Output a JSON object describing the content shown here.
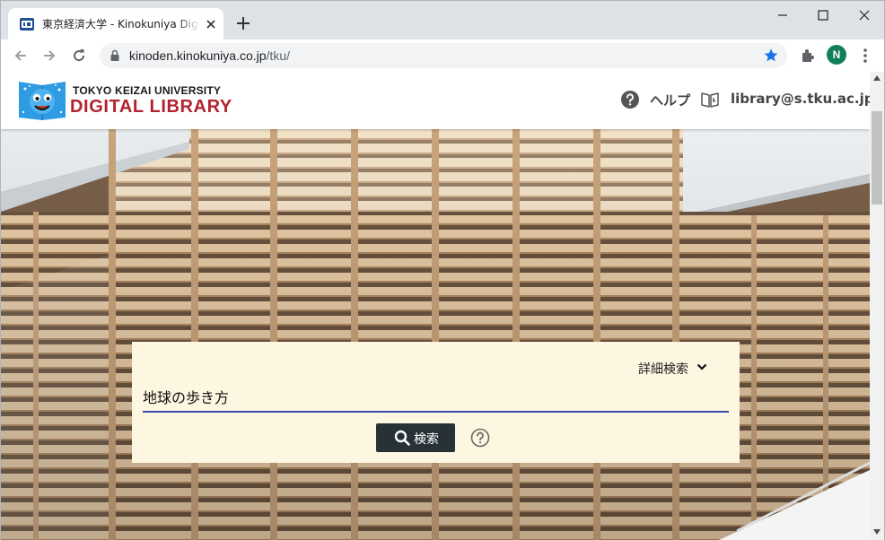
{
  "browser": {
    "tab_title": "東京経済大学 - Kinokuniya Digital Library",
    "url_host": "kinoden.kinokuniya.co.jp",
    "url_path": "/tku/",
    "profile_initial": "N",
    "colors": {
      "profile": "#137f5a",
      "bookmark_star": "#1a73e8"
    }
  },
  "site": {
    "logo_line1": "TOKYO KEIZAI UNIVERSITY",
    "logo_line2": "DIGITAL LIBRARY",
    "help_label": "ヘルプ",
    "account_label": "library@s.tku.ac.jp",
    "colors": {
      "logo_accent": "#b2232f",
      "logo_mascot": "#2f9be3"
    }
  },
  "search": {
    "advanced_label": "詳細検索",
    "query_value": "地球の歩き方",
    "button_label": "検索",
    "colors": {
      "panel": "#fdf6e0",
      "button": "#263238",
      "underline": "#3b4aa8"
    }
  }
}
